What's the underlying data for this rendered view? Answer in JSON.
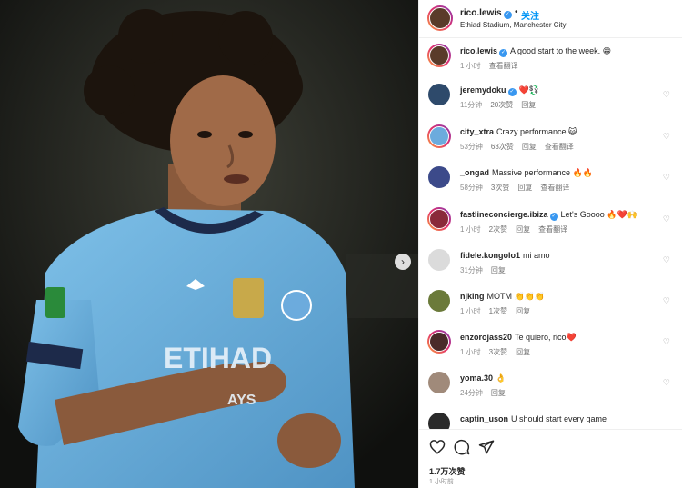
{
  "post": {
    "author": "rico.lewis",
    "follow_label": "关注",
    "dot": "•",
    "location": "Ethiad Stadium, Manchester City",
    "next_arrow": "›"
  },
  "comments": [
    {
      "user": "rico.lewis",
      "verified": true,
      "text": "A good start to the week. 😁",
      "time": "1 小时",
      "likes": "",
      "reply": "",
      "translate": "查看翻译",
      "avatar_color": "#5a3b2a"
    },
    {
      "user": "jeremydoku",
      "verified": true,
      "text": "❤️💱",
      "time": "11分钟",
      "likes": "20次赞",
      "reply": "回复",
      "translate": "",
      "avatar_color": "#2e4a6b"
    },
    {
      "user": "city_xtra",
      "verified": false,
      "text": "Crazy performance 😺",
      "time": "53分钟",
      "likes": "63次赞",
      "reply": "回复",
      "translate": "查看翻译",
      "avatar_color": "#6cabdd"
    },
    {
      "user": "_ongad",
      "verified": false,
      "text": "Massive performance 🔥🔥",
      "time": "58分钟",
      "likes": "3次赞",
      "reply": "回复",
      "translate": "查看翻译",
      "avatar_color": "#3c4a8a"
    },
    {
      "user": "fastlineconcierge.ibiza",
      "verified": true,
      "text": "Let's Goooo 🔥❤️🙌",
      "time": "1 小时",
      "likes": "2次赞",
      "reply": "回复",
      "translate": "查看翻译",
      "avatar_color": "#8a2a3a"
    },
    {
      "user": "fidele.kongolo1",
      "verified": false,
      "text": "mi amo",
      "time": "31分钟",
      "likes": "",
      "reply": "回复",
      "translate": "",
      "avatar_color": "#dbdbdb"
    },
    {
      "user": "njking",
      "verified": false,
      "text": "MOTM 👏👏👏",
      "time": "1 小时",
      "likes": "1次赞",
      "reply": "回复",
      "translate": "",
      "avatar_color": "#6b7a3a"
    },
    {
      "user": "enzorojass20",
      "verified": false,
      "text": "Te quiero, rico❤️",
      "time": "1 小时",
      "likes": "3次赞",
      "reply": "回复",
      "translate": "",
      "avatar_color": "#4a2a2a"
    },
    {
      "user": "yoma.30",
      "verified": false,
      "text": "👌",
      "time": "24分钟",
      "likes": "",
      "reply": "回复",
      "translate": "",
      "avatar_color": "#a08a7a"
    },
    {
      "user": "captin_uson",
      "verified": false,
      "text": "U should start every game",
      "time": "",
      "likes": "",
      "reply": "",
      "translate": "",
      "avatar_color": "#2a2a2a"
    }
  ],
  "footer": {
    "likes": "1.7万次赞",
    "time": "1 小时前"
  },
  "icons": {
    "like": "heart-icon",
    "comment": "comment-icon",
    "share": "share-icon",
    "next": "chevron-right-icon",
    "verified": "verified-badge-icon"
  },
  "colors": {
    "accent": "#0095f6",
    "verified": "#3897f0",
    "jersey": "#6cabdd"
  }
}
